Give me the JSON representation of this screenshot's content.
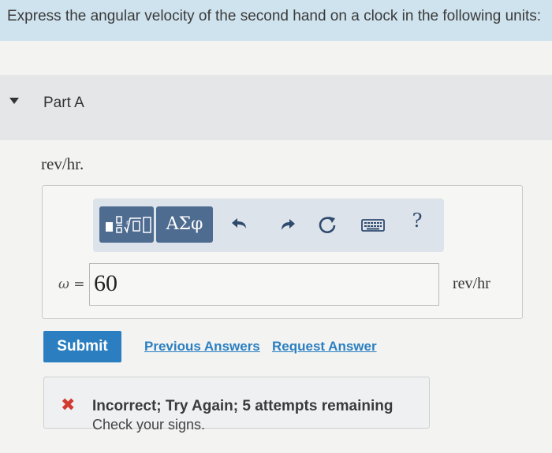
{
  "prompt": "Express the angular velocity of the second hand on a clock in the following units:",
  "part": {
    "title": "Part A",
    "units_line": "rev/hr."
  },
  "toolbar": {
    "greek_label": "ΑΣφ",
    "icons": [
      "templates-icon",
      "greek-symbols-icon",
      "undo-icon",
      "redo-icon",
      "reset-icon",
      "keyboard-icon",
      "help-icon"
    ],
    "help_label": "?"
  },
  "answer": {
    "variable_label": "ω =",
    "value": "60",
    "units": "rev/hr"
  },
  "actions": {
    "submit_label": "Submit",
    "previous_answers_label": "Previous Answers",
    "request_answer_label": "Request Answer"
  },
  "feedback": {
    "title": "Incorrect; Try Again; 5 attempts remaining",
    "message": "Check your signs."
  },
  "colors": {
    "prompt_bg": "#cfe3ee",
    "toolbar_button": "#4e6b90",
    "submit_button": "#2b7fc1",
    "link": "#2b7fc1",
    "error": "#d23b2f"
  }
}
